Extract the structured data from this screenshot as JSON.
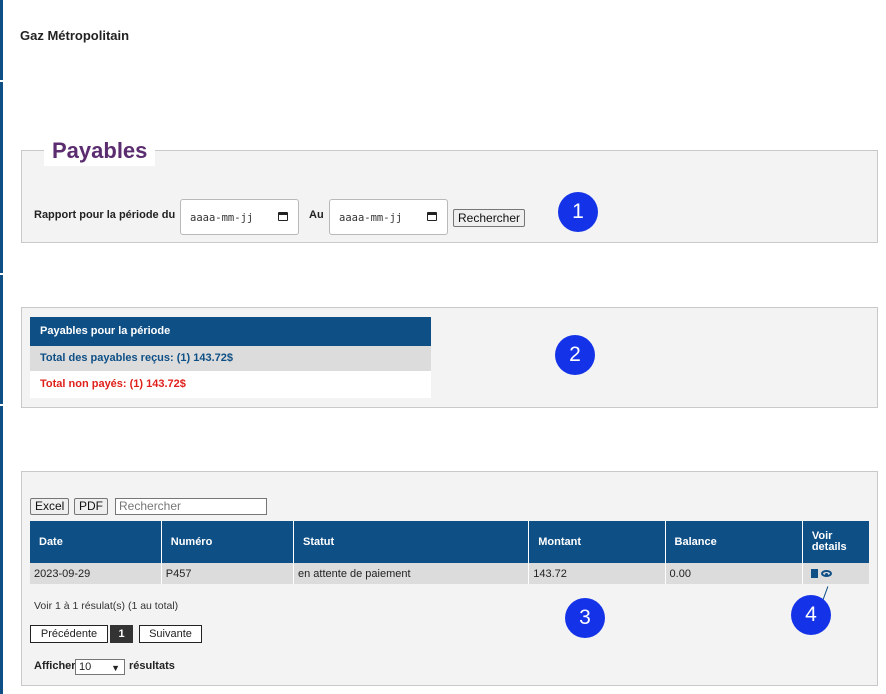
{
  "header": {
    "company": "Gaz Métropolitain"
  },
  "payables_panel": {
    "title": "Payables",
    "period_label": "Rapport pour la période du",
    "date_from_placeholder": "aaaa-mm-jj",
    "to_label": "Au",
    "date_to_placeholder": "aaaa-mm-jj",
    "search_button": "Rechercher"
  },
  "summary": {
    "header": "Payables pour la période",
    "total_received": "Total des payables reçus:   (1)  143.72$",
    "total_unpaid": "Total non payés:   (1)  143.72$"
  },
  "toolbar": {
    "excel": "Excel",
    "pdf": "PDF",
    "search_placeholder": "Rechercher"
  },
  "table": {
    "columns": [
      "Date",
      "Numéro",
      "Statut",
      "Montant",
      "Balance",
      "Voir details"
    ],
    "rows": [
      {
        "date": "2023-09-29",
        "numero": "P457",
        "statut": "en attente de paiement",
        "montant": "143.72",
        "balance": "0.00"
      }
    ]
  },
  "pagination": {
    "info": "Voir 1 à 1 résulat(s) (1 au total)",
    "previous": "Précédente",
    "current": "1",
    "next": "Suivante"
  },
  "length": {
    "show_label": "Afficher",
    "value": "10",
    "suffix": "résultats"
  },
  "annotations": [
    "1",
    "2",
    "3",
    "4"
  ],
  "colors": {
    "primary": "#0e4f86",
    "title": "#5b2c6f",
    "danger": "#e0201b",
    "badge": "#1433e8"
  },
  "icons": {
    "date_picker": "calendar-icon",
    "row_pdf": "pdf-icon",
    "row_view": "eye-icon",
    "select_chevron": "chevron-down-icon"
  }
}
